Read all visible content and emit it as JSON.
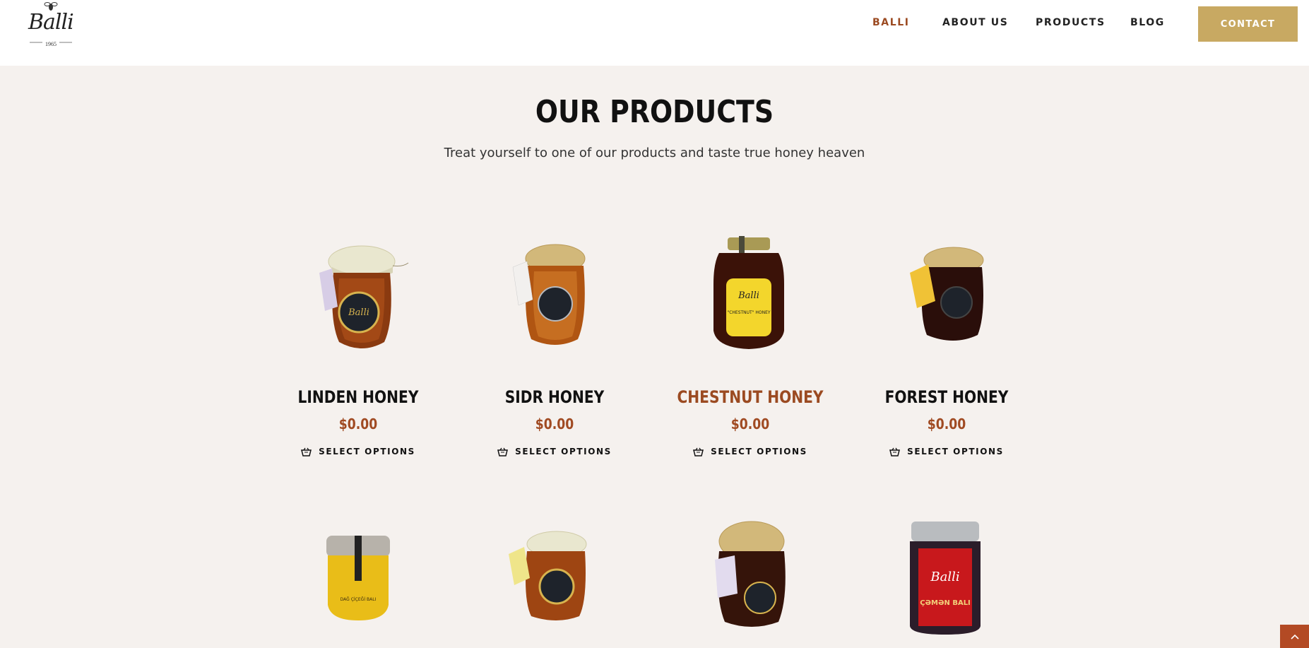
{
  "header": {
    "logo_text": "Balli",
    "logo_year": "1965",
    "nav": [
      "BALLI",
      "ABOUT US",
      "PRODUCTS",
      "BLOG"
    ],
    "contact_label": "CONTACT"
  },
  "main": {
    "title": "OUR PRODUCTS",
    "subtitle": "Treat yourself to one of our products and taste true honey heaven"
  },
  "products": [
    {
      "name": "LINDEN HONEY",
      "price": "$0.00",
      "option": "SELECT OPTIONS"
    },
    {
      "name": "SIDR HONEY",
      "price": "$0.00",
      "option": "SELECT OPTIONS"
    },
    {
      "name": "CHESTNUT HONEY",
      "price": "$0.00",
      "option": "SELECT OPTIONS"
    },
    {
      "name": "FOREST HONEY",
      "price": "$0.00",
      "option": "SELECT OPTIONS"
    }
  ],
  "colors": {
    "accent": "#9b4a21",
    "contact_bg": "#c8a962",
    "page_bg": "#f5f1ee",
    "scroll_top_bg": "#b34a24"
  },
  "icons": [
    "basket-icon",
    "chevron-up-icon",
    "bee-icon"
  ]
}
